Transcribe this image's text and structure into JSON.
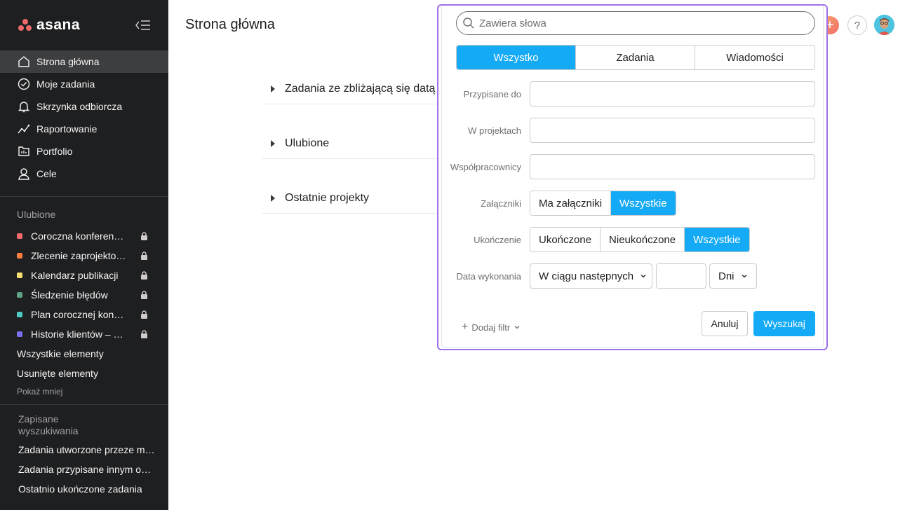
{
  "app": {
    "logo_text": "asana"
  },
  "sidebar": {
    "nav": [
      {
        "label": "Strona główna",
        "icon": "home-icon"
      },
      {
        "label": "Moje zadania",
        "icon": "check-circle-icon"
      },
      {
        "label": "Skrzynka odbiorcza",
        "icon": "bell-icon"
      },
      {
        "label": "Raportowanie",
        "icon": "chart-line-icon"
      },
      {
        "label": "Portfolio",
        "icon": "portfolio-icon"
      },
      {
        "label": "Cele",
        "icon": "person-icon"
      }
    ],
    "favorites_title": "Ulubione",
    "favorites": [
      {
        "label": "Coroczna konferencja",
        "color": "#f06a6a"
      },
      {
        "label": "Zlecenie zaprojektowania",
        "color": "#fd7e40"
      },
      {
        "label": "Kalendarz publikacji",
        "color": "#f8df72"
      },
      {
        "label": "Śledzenie błędów",
        "color": "#5da283"
      },
      {
        "label": "Plan corocznej konferencji",
        "color": "#4ecbc4"
      },
      {
        "label": "Historie klientów – opinie",
        "color": "#7a6ff0"
      }
    ],
    "all_items": "Wszystkie elementy",
    "deleted_items": "Usunięte elementy",
    "show_less": "Pokaż mniej",
    "saved_title": "Zapisane wyszukiwania",
    "saved": [
      "Zadania utworzone przeze mnie",
      "Zadania przypisane innym osobom",
      "Ostatnio ukończone zadania"
    ]
  },
  "main": {
    "title": "Strona główna",
    "sections": [
      "Zadania ze zbliżającą się datą",
      "Ulubione",
      "Ostatnie projekty"
    ]
  },
  "search_popup": {
    "placeholder": "Zawiera słowa",
    "tabs": [
      "Wszystko",
      "Zadania",
      "Wiadomości"
    ],
    "active_tab": "Wszystko",
    "labels": {
      "assigned": "Przypisane do",
      "in_projects": "W projektach",
      "collaborators": "Współpracownicy",
      "attachments": "Załączniki",
      "completion": "Ukończenie",
      "due_date": "Data wykonania"
    },
    "attachments_options": [
      "Ma załączniki",
      "Wszystkie"
    ],
    "attachments_selected": "Wszystkie",
    "completion_options": [
      "Ukończone",
      "Nieukończone",
      "Wszystkie"
    ],
    "completion_selected": "Wszystkie",
    "due_range": "W ciągu następnych",
    "due_unit": "Dni",
    "add_filter": "Dodaj filtr",
    "cancel": "Anuluj",
    "search": "Wyszukaj"
  },
  "colors": {
    "accent": "#14aaf5",
    "popup_border": "#a071e8",
    "sidebar_bg": "#1e1f21"
  }
}
